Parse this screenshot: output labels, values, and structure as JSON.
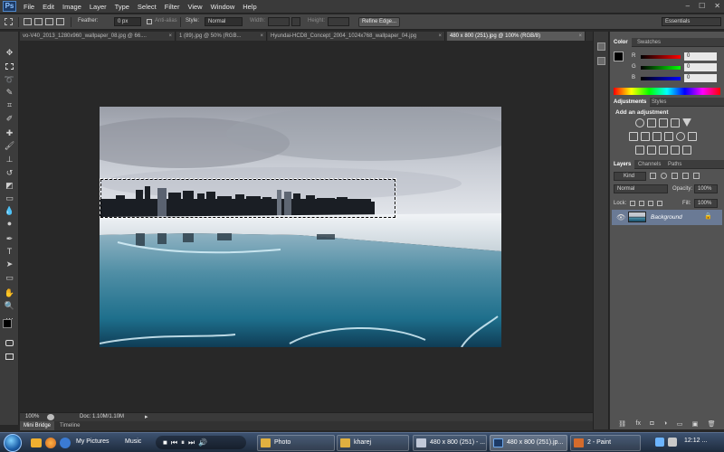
{
  "app": {
    "logo": "Ps",
    "menus": [
      "File",
      "Edit",
      "Image",
      "Layer",
      "Type",
      "Select",
      "Filter",
      "View",
      "Window",
      "Help"
    ],
    "window_controls": [
      "–",
      "☐",
      "✕"
    ]
  },
  "options_bar": {
    "feather_label": "Feather:",
    "feather_value": "0 px",
    "antialias_label": "Anti-alias",
    "style_label": "Style:",
    "style_value": "Normal",
    "width_label": "Width:",
    "height_label": "Height:",
    "refine_edge": "Refine Edge...",
    "workspace": "Essentials"
  },
  "doc_tabs": [
    {
      "label": "vo-V40_2013_1280x960_wallpaper_08.jpg @ 66....",
      "active": false
    },
    {
      "label": "1 (89).jpg @ 50% (RGB...",
      "active": false
    },
    {
      "label": "Hyundai-HCD8_Concept_2004_1024x768_wallpaper_04.jpg",
      "active": false
    },
    {
      "label": "480 x 800 (251).jpg @ 100% (RGB/8)",
      "active": true
    }
  ],
  "status_bar": {
    "zoom": "100%",
    "doc_info": "Doc: 1.10M/1.10M"
  },
  "bottom_tabs": [
    "Mini Bridge",
    "Timeline"
  ],
  "color_panel": {
    "tabs": [
      "Color",
      "Swatches"
    ],
    "channels": [
      {
        "label": "R",
        "value": "0",
        "color": "#ff0000"
      },
      {
        "label": "G",
        "value": "0",
        "color": "#00ff00"
      },
      {
        "label": "B",
        "value": "0",
        "color": "#0000ff"
      }
    ]
  },
  "adjustments_panel": {
    "tabs": [
      "Adjustments",
      "Styles"
    ],
    "heading": "Add an adjustment"
  },
  "layers_panel": {
    "tabs": [
      "Layers",
      "Channels",
      "Paths"
    ],
    "kind_label": "Kind",
    "blend_mode": "Normal",
    "opacity_label": "Opacity:",
    "opacity_value": "100%",
    "lock_label": "Lock:",
    "fill_label": "Fill:",
    "fill_value": "100%",
    "layer_name": "Background"
  },
  "taskbar": {
    "items": [
      {
        "label": "My Pictures",
        "type": "plain"
      },
      {
        "label": "Music",
        "type": "plain"
      },
      {
        "label": "Photo",
        "type": "button"
      },
      {
        "label": "kharej",
        "type": "button"
      },
      {
        "label": "480 x 800 (251) - ...",
        "type": "button"
      },
      {
        "label": "480 x 800 (251).jp...",
        "type": "button"
      },
      {
        "label": "2 - Paint",
        "type": "button"
      }
    ],
    "clock": "12:12 ..."
  },
  "colors": {
    "accent": "#1c3a66",
    "panel_bg": "#535353",
    "workspace_bg": "#282828",
    "selected_layer": "#6a7a95"
  }
}
